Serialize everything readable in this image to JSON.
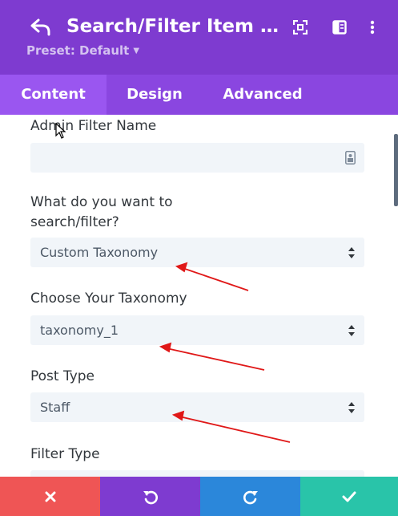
{
  "header": {
    "title": "Search/Filter Item Sett…",
    "preset_label": "Preset: Default",
    "icons": [
      "back-icon",
      "expand-icon",
      "split-view-icon",
      "more-vertical-icon"
    ],
    "background": "#7e3bd0"
  },
  "tabs": [
    {
      "label": "Content",
      "active": true
    },
    {
      "label": "Design",
      "active": false
    },
    {
      "label": "Advanced",
      "active": false
    }
  ],
  "form": {
    "admin_filter_name": {
      "label": "Admin Filter Name",
      "value": ""
    },
    "search_filter": {
      "label": "What do you want to search/filter?",
      "value": "Custom Taxonomy"
    },
    "taxonomy": {
      "label": "Choose Your Taxonomy",
      "value": "taxonomy_1"
    },
    "post_type": {
      "label": "Post Type",
      "value": "Staff"
    },
    "filter_type": {
      "label": "Filter Type"
    }
  },
  "footer": {
    "buttons": [
      {
        "name": "cancel",
        "icon": "close-icon",
        "color": "#ef5555"
      },
      {
        "name": "undo",
        "icon": "undo-icon",
        "color": "#7e3bd0"
      },
      {
        "name": "redo",
        "icon": "redo-icon",
        "color": "#2b87da"
      },
      {
        "name": "save",
        "icon": "check-icon",
        "color": "#29c4a9"
      }
    ]
  },
  "annotation_color": "#e01818"
}
